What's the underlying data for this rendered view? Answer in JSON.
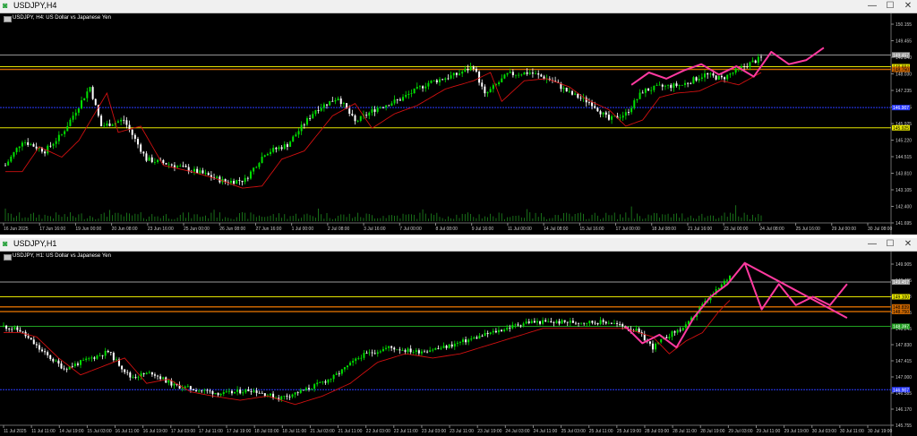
{
  "windows": [
    {
      "title": "USDJPY,H4",
      "symbol_label": "USDJPY, H4:  US Dollar vs Japanese Yen",
      "buttons": {
        "minimize": "—",
        "maximize": "☐",
        "close": "✕"
      }
    },
    {
      "title": "USDJPY,H1",
      "symbol_label": "USDJPY, H1:  US Dollar vs Japanese Yen",
      "buttons": {
        "minimize": "—",
        "maximize": "☐",
        "close": "✕"
      }
    }
  ],
  "colors": {
    "bull": "#00e000",
    "bear": "#ffffff",
    "ma": "#d01010",
    "hline_yellow": "#e6e600",
    "hline_blue": "#2a3aff",
    "hline_gray": "#9a9a9a",
    "hline_orange": "#c86400",
    "projection": "#ff3aa0",
    "grid_bg": "#000000",
    "axis_text": "#c8c8c8"
  },
  "chart_data": [
    {
      "type": "candlestick",
      "timeframe": "H4",
      "ylim": [
        141.4,
        151.2
      ],
      "y_ticks": [
        "150.155",
        "149.455",
        "148.840",
        "148.030",
        "147.235",
        "146.625",
        "145.925",
        "145.220",
        "144.515",
        "143.810",
        "143.105",
        "142.400",
        "141.695"
      ],
      "price_labels": [
        {
          "text": "149.457",
          "kind": "gray",
          "value": 149.45
        },
        {
          "text": "148.884",
          "kind": "yellow",
          "value": 148.88
        },
        {
          "text": "148.750",
          "kind": "orange",
          "value": 148.75
        },
        {
          "text": "146.907",
          "kind": "blue",
          "value": 146.9
        },
        {
          "text": "145.925",
          "kind": "yellow",
          "value": 145.92
        }
      ],
      "x_labels": [
        "16 Jun 2025",
        "17 Jun 16:00",
        "19 Jun 00:00",
        "20 Jun 08:00",
        "23 Jun 16:00",
        "25 Jun 00:00",
        "26 Jun 08:00",
        "27 Jun 16:00",
        "1 Jul 00:00",
        "2 Jul 08:00",
        "3 Jul 16:00",
        "7 Jul 00:00",
        "8 Jul 08:00",
        "9 Jul 16:00",
        "11 Jul 00:00",
        "14 Jul 08:00",
        "15 Jul 16:00",
        "17 Jul 00:00",
        "18 Jul 08:00",
        "21 Jul 16:00",
        "23 Jul 00:00",
        "24 Jul 08:00",
        "25 Jul 16:00",
        "29 Jul 00:00",
        "30 Jul 08:00"
      ],
      "anchors": [
        [
          0,
          144.1
        ],
        [
          6,
          145.3
        ],
        [
          14,
          144.8
        ],
        [
          20,
          145.6
        ],
        [
          30,
          147.9
        ],
        [
          34,
          146.0
        ],
        [
          42,
          146.3
        ],
        [
          50,
          144.4
        ],
        [
          60,
          144.1
        ],
        [
          70,
          143.7
        ],
        [
          78,
          143.3
        ],
        [
          85,
          143.4
        ],
        [
          92,
          144.7
        ],
        [
          100,
          145.1
        ],
        [
          110,
          146.8
        ],
        [
          118,
          147.4
        ],
        [
          124,
          146.2
        ],
        [
          132,
          146.9
        ],
        [
          140,
          147.3
        ],
        [
          150,
          148.1
        ],
        [
          160,
          148.5
        ],
        [
          166,
          148.9
        ],
        [
          170,
          147.5
        ],
        [
          178,
          148.5
        ],
        [
          186,
          148.6
        ],
        [
          194,
          148.2
        ],
        [
          200,
          147.6
        ],
        [
          208,
          147.1
        ],
        [
          214,
          146.3
        ],
        [
          220,
          146.6
        ],
        [
          226,
          147.7
        ],
        [
          232,
          147.9
        ],
        [
          240,
          148.0
        ],
        [
          248,
          148.5
        ],
        [
          254,
          148.3
        ],
        [
          262,
          148.9
        ],
        [
          268,
          149.3
        ]
      ],
      "ma_offset": -0.5,
      "projection": [
        [
          0,
          148.0
        ],
        [
          2,
          148.6
        ],
        [
          4,
          148.3
        ],
        [
          6,
          148.7
        ],
        [
          8,
          149.0
        ],
        [
          10,
          148.5
        ],
        [
          12,
          148.9
        ],
        [
          14,
          148.4
        ],
        [
          16,
          149.6
        ],
        [
          18,
          149.0
        ],
        [
          20,
          149.2
        ],
        [
          22,
          149.8
        ]
      ]
    },
    {
      "type": "candlestick",
      "timeframe": "H1",
      "ylim": [
        146.1,
        150.0
      ],
      "y_ticks": [
        "149.905",
        "149.455",
        "149.118",
        "148.595",
        "148.245",
        "147.830",
        "147.415",
        "147.000",
        "146.585",
        "146.170",
        "145.755"
      ],
      "price_labels": [
        {
          "text": "149.457",
          "kind": "gray",
          "value": 149.45
        },
        {
          "text": "149.100",
          "kind": "yellow",
          "value": 149.1
        },
        {
          "text": "148.839",
          "kind": "orange",
          "value": 148.86
        },
        {
          "text": "148.750",
          "kind": "orange",
          "value": 148.75
        },
        {
          "text": "148.397",
          "kind": "green",
          "value": 148.4
        },
        {
          "text": "146.907",
          "kind": "blue",
          "value": 146.9
        }
      ],
      "x_labels": [
        "11 Jul 2025",
        "11 Jul 11:00",
        "14 Jul 19:00",
        "15 Jul 03:00",
        "16 Jul 11:00",
        "16 Jul 19:00",
        "17 Jul 03:00",
        "17 Jul 11:00",
        "17 Jul 19:00",
        "18 Jul 03:00",
        "18 Jul 11:00",
        "21 Jul 03:00",
        "21 Jul 11:00",
        "22 Jul 03:00",
        "22 Jul 11:00",
        "23 Jul 03:00",
        "23 Jul 11:00",
        "23 Jul 19:00",
        "24 Jul 03:00",
        "24 Jul 11:00",
        "25 Jul 03:00",
        "25 Jul 11:00",
        "25 Jul 19:00",
        "28 Jul 03:00",
        "28 Jul 11:00",
        "28 Jul 19:00",
        "29 Jul 03:00",
        "29 Jul 11:00",
        "29 Jul 19:00",
        "30 Jul 03:00",
        "30 Jul 11:00",
        "30 Jul 19:00"
      ],
      "anchors": [
        [
          0,
          148.4
        ],
        [
          6,
          148.3
        ],
        [
          14,
          147.8
        ],
        [
          22,
          147.4
        ],
        [
          30,
          147.6
        ],
        [
          38,
          147.8
        ],
        [
          46,
          147.2
        ],
        [
          54,
          147.3
        ],
        [
          62,
          147.0
        ],
        [
          70,
          146.9
        ],
        [
          80,
          146.8
        ],
        [
          90,
          146.9
        ],
        [
          100,
          146.7
        ],
        [
          110,
          146.9
        ],
        [
          120,
          147.2
        ],
        [
          130,
          147.7
        ],
        [
          140,
          147.9
        ],
        [
          150,
          147.8
        ],
        [
          160,
          147.9
        ],
        [
          170,
          148.1
        ],
        [
          180,
          148.3
        ],
        [
          190,
          148.5
        ],
        [
          200,
          148.5
        ],
        [
          210,
          148.5
        ],
        [
          220,
          148.5
        ],
        [
          230,
          148.3
        ],
        [
          236,
          147.9
        ],
        [
          242,
          148.2
        ],
        [
          248,
          148.4
        ],
        [
          254,
          148.9
        ],
        [
          260,
          149.3
        ],
        [
          264,
          149.6
        ]
      ],
      "ma_offset": -0.25,
      "projection_a": [
        [
          0,
          148.4
        ],
        [
          2,
          148.0
        ],
        [
          4,
          148.2
        ],
        [
          6,
          147.9
        ],
        [
          8,
          148.6
        ],
        [
          10,
          149.1
        ],
        [
          12,
          149.4
        ],
        [
          14,
          149.9
        ],
        [
          16,
          148.8
        ],
        [
          18,
          149.4
        ],
        [
          20,
          148.9
        ],
        [
          22,
          149.1
        ],
        [
          24,
          148.9
        ],
        [
          26,
          149.4
        ]
      ],
      "projection_b": [
        [
          14,
          149.9
        ],
        [
          26,
          148.6
        ]
      ],
      "projection_c": [
        [
          18,
          149.25
        ],
        [
          28,
          148.2
        ]
      ]
    }
  ]
}
